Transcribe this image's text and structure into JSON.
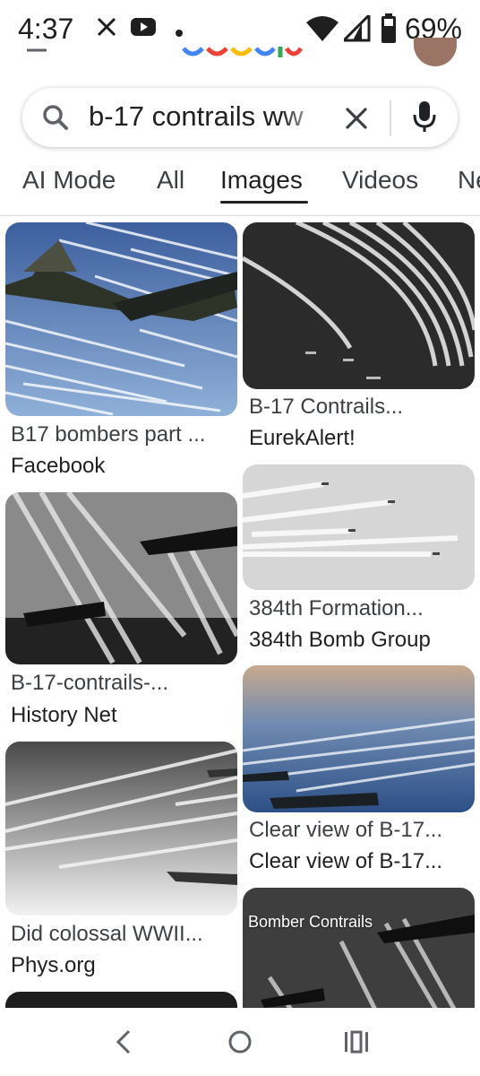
{
  "status_bar": {
    "time": "4:37",
    "battery_percent": "69%",
    "left_icons": [
      "x-logo-icon",
      "youtube-icon",
      "notification-dot-icon"
    ],
    "right_icons": [
      "wifi-icon",
      "signal-icon",
      "battery-icon"
    ]
  },
  "search": {
    "query": "b-17 contrails ww",
    "icons": [
      "search-icon",
      "clear-icon",
      "mic-icon"
    ]
  },
  "tabs": [
    {
      "label": "AI Mode",
      "active": false
    },
    {
      "label": "All",
      "active": false
    },
    {
      "label": "Images",
      "active": true
    },
    {
      "label": "Videos",
      "active": false
    },
    {
      "label": "Ne",
      "active": false
    }
  ],
  "results": [
    {
      "title": "B17 bombers part ...",
      "source": "Facebook"
    },
    {
      "title": "B-17 Contrails...",
      "source": "EurekAlert!"
    },
    {
      "title": "B-17-contrails-...",
      "source": "History Net"
    },
    {
      "title": "384th Formation...",
      "source": "384th Bomb Group"
    },
    {
      "title": "Did colossal WWII...",
      "source": "Phys.org"
    },
    {
      "title": "Clear view of B-17...",
      "source": "Clear view of B-17..."
    },
    {
      "title": "",
      "source": "",
      "overlay": "Bomber Contrails"
    }
  ],
  "colors": {
    "accent": "#202124",
    "google_blue": "#4285f4",
    "google_red": "#ea4335",
    "google_yellow": "#fbbc05",
    "google_green": "#34a853"
  },
  "nav_icons": [
    "back-icon",
    "home-icon",
    "recents-icon"
  ]
}
